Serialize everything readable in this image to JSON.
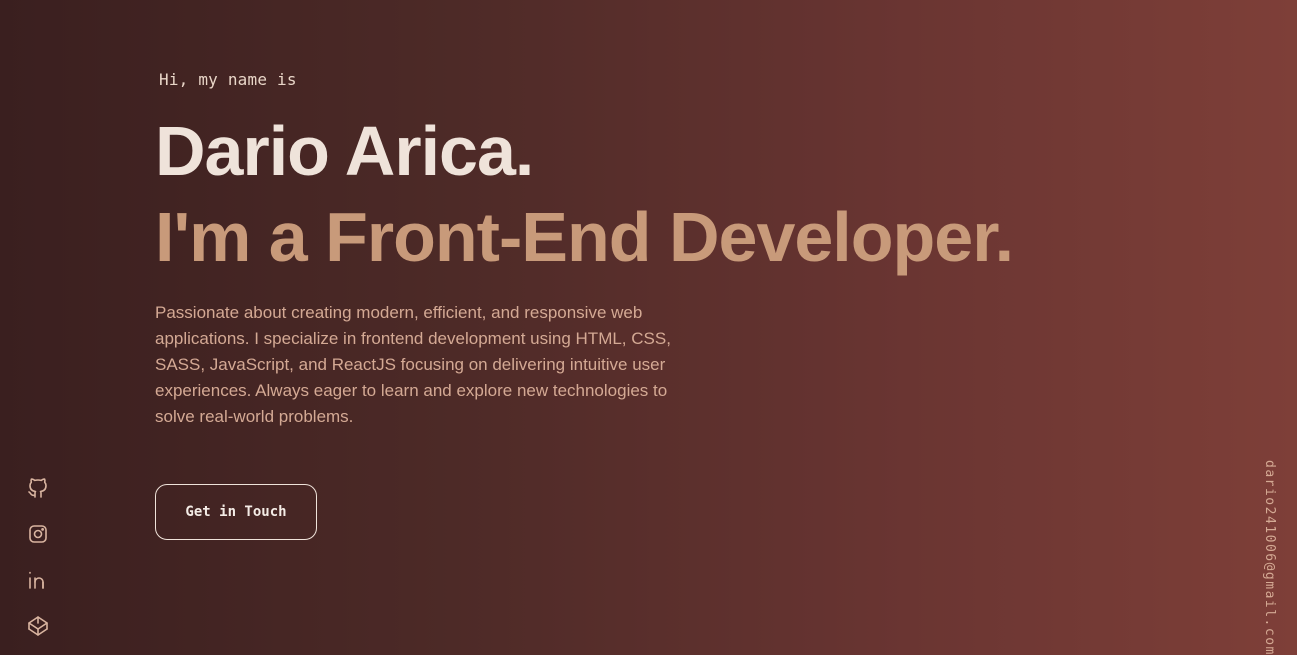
{
  "hero": {
    "greeting": "Hi, my name is",
    "name": "Dario Arica.",
    "role": "I'm a Front-End Developer.",
    "bio": "Passionate about creating modern, efficient, and responsive web applications. I specialize in frontend development using HTML, CSS, SASS, JavaScript, and ReactJS focusing on delivering intuitive user experiences. Always eager to learn and explore new technologies to solve real-world problems.",
    "cta_label": "Get in Touch"
  },
  "socials": [
    {
      "icon": "github-icon"
    },
    {
      "icon": "instagram-icon"
    },
    {
      "icon": "linkedin-icon"
    },
    {
      "icon": "codepen-icon"
    }
  ],
  "email": "dario241006@gmail.com",
  "colors": {
    "background_start": "#3a1f1f",
    "background_end": "#7e3f38",
    "name": "#efe3da",
    "role": "#c89a7a",
    "bio": "#d4a994",
    "icon": "#d9b4a0"
  }
}
